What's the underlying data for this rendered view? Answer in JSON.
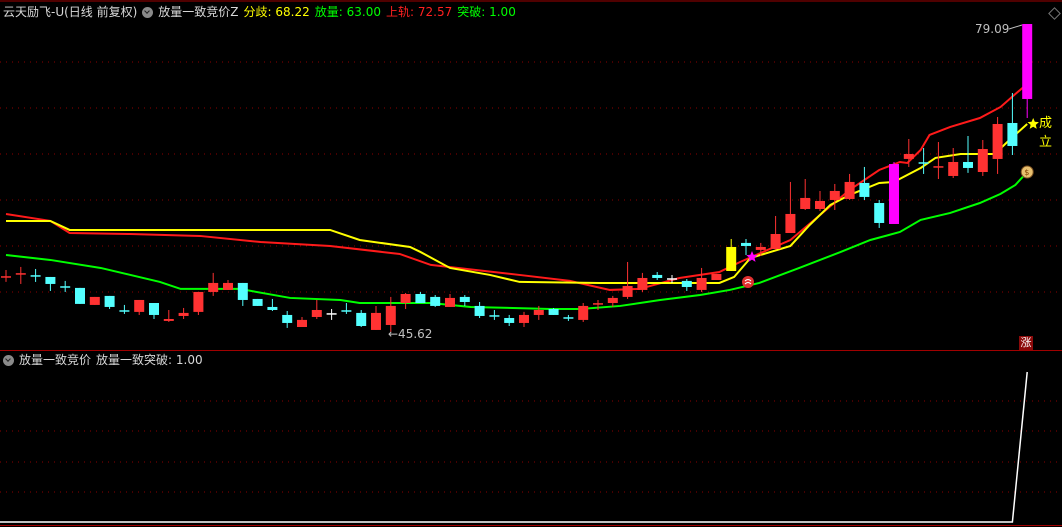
{
  "header": {
    "stock": "云天励飞-U(日线 前复权)",
    "indicator": "放量一致竞价Z",
    "fenqi_label": "分歧:",
    "fenqi_value": "68.22",
    "fangliang_label": "放量:",
    "fangliang_value": "63.00",
    "shanggui_label": "上轨:",
    "shanggui_value": "72.57",
    "tupo_label": "突破:",
    "tupo_value": "1.00"
  },
  "sub_header": {
    "indicator": "放量一致竞价",
    "series_label": "放量一致突破:",
    "series_value": "1.00"
  },
  "annotations": {
    "high_label": "79.09",
    "low_label": "←45.62",
    "signal_text": "成立",
    "zhang_badge": "涨"
  },
  "colors": {
    "up": "#ff3232",
    "down": "#54ffff",
    "flat": "#ffffff",
    "signal_yellow": "#ffff00",
    "signal_magenta": "#ff00ff",
    "upper": "#ff1a1a",
    "fenqi": "#ffff00",
    "lower": "#00ff00",
    "grid": "#8b0000"
  },
  "chart_data": {
    "type": "candlestick",
    "ylim": [
      43.65,
      81.7
    ],
    "candles_fields": [
      "open",
      "close",
      "high",
      "low",
      "type"
    ],
    "candles": [
      [
        51.59,
        51.59,
        52.35,
        51.05,
        "u"
      ],
      [
        51.92,
        51.92,
        52.68,
        50.83,
        "u"
      ],
      [
        51.7,
        51.7,
        52.46,
        51.05,
        "d"
      ],
      [
        51.59,
        50.83,
        51.59,
        50.07,
        "d"
      ],
      [
        50.5,
        50.5,
        51.16,
        49.96,
        "d"
      ],
      [
        50.4,
        48.66,
        50.4,
        48.66,
        "d"
      ],
      [
        48.55,
        49.42,
        49.42,
        48.55,
        "u"
      ],
      [
        49.53,
        48.33,
        49.53,
        48.11,
        "d"
      ],
      [
        47.89,
        47.89,
        48.55,
        47.57,
        "d"
      ],
      [
        47.79,
        49.09,
        49.09,
        47.46,
        "u"
      ],
      [
        48.76,
        47.46,
        48.76,
        47.02,
        "d"
      ],
      [
        46.81,
        47.02,
        48.0,
        46.7,
        "u"
      ],
      [
        47.35,
        47.68,
        48.22,
        47.02,
        "u"
      ],
      [
        47.79,
        49.96,
        49.96,
        47.46,
        "u"
      ],
      [
        49.96,
        50.94,
        52.03,
        49.53,
        "u"
      ],
      [
        50.18,
        50.94,
        51.26,
        50.18,
        "u"
      ],
      [
        50.94,
        49.09,
        50.94,
        48.44,
        "d"
      ],
      [
        49.2,
        48.44,
        49.2,
        48.44,
        "d"
      ],
      [
        48.33,
        48.0,
        49.2,
        47.89,
        "d"
      ],
      [
        47.46,
        46.59,
        47.89,
        46.05,
        "d"
      ],
      [
        46.15,
        46.92,
        47.24,
        46.15,
        "u"
      ],
      [
        47.24,
        48.0,
        49.09,
        47.02,
        "u"
      ],
      [
        47.57,
        47.57,
        48.11,
        46.92,
        "f"
      ],
      [
        47.89,
        47.89,
        48.76,
        47.57,
        "d"
      ],
      [
        47.68,
        46.26,
        48.0,
        46.15,
        "d"
      ],
      [
        45.83,
        47.68,
        48.44,
        45.83,
        "u"
      ],
      [
        46.37,
        48.44,
        49.42,
        45.62,
        "u"
      ],
      [
        48.76,
        49.74,
        49.85,
        48.11,
        "u"
      ],
      [
        49.74,
        48.76,
        49.96,
        48.76,
        "d"
      ],
      [
        49.42,
        48.44,
        49.63,
        48.33,
        "d"
      ],
      [
        48.33,
        49.31,
        49.74,
        48.33,
        "u"
      ],
      [
        49.42,
        48.87,
        49.63,
        48.44,
        "d"
      ],
      [
        48.44,
        47.35,
        48.87,
        47.13,
        "d"
      ],
      [
        47.35,
        47.35,
        48.0,
        46.92,
        "d"
      ],
      [
        47.13,
        46.59,
        47.46,
        46.26,
        "d"
      ],
      [
        46.59,
        47.46,
        47.79,
        46.15,
        "u"
      ],
      [
        47.46,
        48.0,
        48.44,
        46.92,
        "u"
      ],
      [
        48.11,
        47.46,
        48.22,
        47.46,
        "d"
      ],
      [
        47.13,
        47.13,
        47.46,
        46.81,
        "d"
      ],
      [
        46.92,
        48.44,
        48.76,
        46.7,
        "u"
      ],
      [
        48.66,
        48.66,
        49.09,
        48.0,
        "u"
      ],
      [
        48.76,
        49.31,
        49.53,
        48.33,
        "u"
      ],
      [
        49.42,
        50.61,
        53.22,
        49.2,
        "u"
      ],
      [
        50.18,
        51.48,
        52.03,
        49.96,
        "u"
      ],
      [
        51.81,
        51.48,
        52.13,
        51.26,
        "d"
      ],
      [
        51.37,
        51.37,
        51.81,
        50.94,
        "f"
      ],
      [
        51.16,
        50.5,
        51.37,
        50.07,
        "d"
      ],
      [
        50.18,
        51.48,
        52.57,
        49.96,
        "u"
      ],
      [
        51.26,
        51.92,
        51.92,
        51.26,
        "u"
      ],
      [
        52.24,
        54.85,
        55.72,
        52.24,
        "Y"
      ],
      [
        55.29,
        54.96,
        55.72,
        53.98,
        "d"
      ],
      [
        54.53,
        54.85,
        55.29,
        53.87,
        "u"
      ],
      [
        54.63,
        56.26,
        58.22,
        54.53,
        "u"
      ],
      [
        56.37,
        58.44,
        61.92,
        56.37,
        "u"
      ],
      [
        58.98,
        60.18,
        62.24,
        58.87,
        "u"
      ],
      [
        58.98,
        59.85,
        60.94,
        58.76,
        "u"
      ],
      [
        59.96,
        60.94,
        61.7,
        58.87,
        "u"
      ],
      [
        60.07,
        61.92,
        62.79,
        59.96,
        "u"
      ],
      [
        61.81,
        60.29,
        63.55,
        59.96,
        "d"
      ],
      [
        59.63,
        57.46,
        59.96,
        56.92,
        "d"
      ],
      [
        57.35,
        63.87,
        64.09,
        57.35,
        "M"
      ],
      [
        64.42,
        64.96,
        66.59,
        63.55,
        "u"
      ],
      [
        63.98,
        63.98,
        65.61,
        62.79,
        "d"
      ],
      [
        63.44,
        63.55,
        66.26,
        62.24,
        "u"
      ],
      [
        62.57,
        64.09,
        65.61,
        62.35,
        "u"
      ],
      [
        64.09,
        63.44,
        66.92,
        62.9,
        "d"
      ],
      [
        63.0,
        65.5,
        66.48,
        62.57,
        "u"
      ],
      [
        64.42,
        68.22,
        68.98,
        62.79,
        "u"
      ],
      [
        68.33,
        65.83,
        71.59,
        64.85,
        "d"
      ],
      [
        70.94,
        79.09,
        79.09,
        68.87,
        "M"
      ]
    ],
    "lines": [
      {
        "name": "上轨",
        "color_key": "upper",
        "points": [
          [
            0,
            58.44
          ],
          [
            3,
            57.68
          ],
          [
            4.3,
            56.37
          ],
          [
            8.4,
            56.26
          ],
          [
            13.1,
            56.05
          ],
          [
            17.2,
            55.39
          ],
          [
            21.9,
            54.96
          ],
          [
            26.6,
            54.09
          ],
          [
            28.7,
            52.9
          ],
          [
            34.7,
            51.81
          ],
          [
            38.1,
            51.16
          ],
          [
            40.8,
            50.18
          ],
          [
            42.8,
            50.29
          ],
          [
            45.5,
            51.48
          ],
          [
            48.2,
            52.13
          ],
          [
            49.6,
            53.22
          ],
          [
            53,
            55.61
          ],
          [
            55,
            58.33
          ],
          [
            57,
            61.05
          ],
          [
            59,
            63.22
          ],
          [
            60.4,
            64.09
          ],
          [
            60.9,
            63.98
          ],
          [
            61.8,
            65.39
          ],
          [
            62.4,
            67.03
          ],
          [
            63.8,
            67.9
          ],
          [
            65.8,
            68.87
          ],
          [
            67.2,
            70.07
          ],
          [
            68.2,
            71.48
          ],
          [
            69,
            72.57
          ]
        ]
      },
      {
        "name": "分歧",
        "color_key": "fenqi",
        "points": [
          [
            0,
            57.68
          ],
          [
            3,
            57.68
          ],
          [
            4.3,
            56.7
          ],
          [
            21.9,
            56.7
          ],
          [
            23.9,
            55.61
          ],
          [
            27.3,
            54.85
          ],
          [
            28,
            54.31
          ],
          [
            30,
            52.57
          ],
          [
            32.7,
            51.81
          ],
          [
            34.7,
            51.05
          ],
          [
            40.1,
            50.94
          ],
          [
            48.2,
            50.94
          ],
          [
            49.2,
            51.59
          ],
          [
            50.3,
            53.65
          ],
          [
            53,
            54.96
          ],
          [
            54.3,
            57.24
          ],
          [
            55.7,
            59.42
          ],
          [
            57,
            60.51
          ],
          [
            59,
            61.81
          ],
          [
            60,
            61.92
          ],
          [
            61.8,
            63.44
          ],
          [
            62.8,
            64.53
          ],
          [
            64.5,
            64.96
          ],
          [
            66.8,
            64.96
          ],
          [
            67.8,
            66.48
          ],
          [
            69,
            68.22
          ]
        ]
      },
      {
        "name": "放量",
        "color_key": "lower",
        "points": [
          [
            0,
            53.98
          ],
          [
            3,
            53.44
          ],
          [
            6.4,
            52.57
          ],
          [
            10.4,
            51.05
          ],
          [
            11.8,
            50.29
          ],
          [
            15.8,
            50.29
          ],
          [
            19.2,
            49.31
          ],
          [
            22.6,
            49.09
          ],
          [
            23.9,
            48.76
          ],
          [
            28.7,
            48.76
          ],
          [
            31.4,
            48.33
          ],
          [
            36.8,
            48.11
          ],
          [
            38.8,
            48.11
          ],
          [
            41.5,
            48.44
          ],
          [
            44.2,
            49.09
          ],
          [
            46.9,
            49.63
          ],
          [
            48.9,
            50.18
          ],
          [
            50.9,
            50.94
          ],
          [
            53.6,
            52.57
          ],
          [
            56.4,
            54.31
          ],
          [
            58.4,
            55.61
          ],
          [
            60.4,
            56.48
          ],
          [
            61.8,
            57.79
          ],
          [
            63.8,
            58.55
          ],
          [
            65.8,
            59.63
          ],
          [
            67.2,
            60.62
          ],
          [
            68.2,
            61.59
          ],
          [
            69,
            63.0
          ]
        ]
      }
    ],
    "signals": {
      "star_index": 50,
      "ball_index": 50,
      "chengli_index": 69,
      "moneybag_index": 69,
      "high_index": 69,
      "low_index": 26
    },
    "sub_chart": {
      "name": "放量一致突破",
      "ylim": [
        0,
        1
      ],
      "values_nonzero": {
        "69": 1
      },
      "count": 70
    }
  }
}
